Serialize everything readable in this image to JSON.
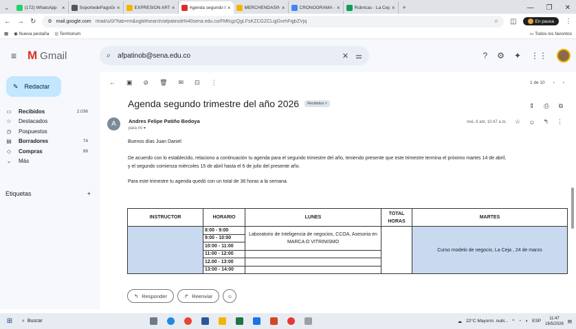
{
  "browser": {
    "tabs": [
      {
        "label": "(172) WhatsApp",
        "color": "#25d366"
      },
      {
        "label": "SoportedePagoGen",
        "color": "#555555"
      },
      {
        "label": "EXPRESIÓN ARTÍSTIC",
        "color": "#f4b400"
      },
      {
        "label": "Agenda segundo tri",
        "color": "#d93025"
      },
      {
        "label": "MERCHENDASING",
        "color": "#f4b400"
      },
      {
        "label": "CRONOGRAMA - Do",
        "color": "#4285f4"
      },
      {
        "label": "Rúbricas - La Ceja",
        "color": "#0f9d58"
      }
    ],
    "new_tab": "+",
    "url_host": "mail.google.com",
    "url_path": "/mail/u/0/?tab=rm&ogbl#search/afpatinob%40sena.edu.co/FMfcgzQgLFsKZCGZCLqjGnrhFqjbZVjq",
    "profile_label": "En pausa",
    "bookmarks": [
      "Nueva pestaña",
      "Territorium"
    ],
    "bookmarks_right": "Todos los favoritos"
  },
  "gmail": {
    "app_name": "Gmail",
    "search_query": "afpatinob@sena.edu.co",
    "compose_label": "Redactar",
    "nav": [
      {
        "label": "Recibidos",
        "count": "2.036",
        "icon": "inbox-icon",
        "bold": true
      },
      {
        "label": "Destacados",
        "count": "",
        "icon": "star-icon",
        "bold": false
      },
      {
        "label": "Pospuestos",
        "count": "",
        "icon": "clock-icon",
        "bold": false
      },
      {
        "label": "Borradores",
        "count": "74",
        "icon": "draft-icon",
        "bold": true
      },
      {
        "label": "Compras",
        "count": "99",
        "icon": "tag-icon",
        "bold": true
      },
      {
        "label": "Más",
        "count": "",
        "icon": "chevron-down-icon",
        "bold": false
      }
    ],
    "labels_heading": "Etiquetas",
    "pagination": "1 de 10"
  },
  "email": {
    "subject": "Agenda segundo trimestre del año 2026",
    "label_badge": "Recibidos ×",
    "sender_initial": "A",
    "sender_name": "Andres Felipe Patiño Bedoya",
    "to": "para mí ▾",
    "date": "mié, 8 abr, 10:47 a.m.",
    "greeting": "Buenos días  Juan Daniel",
    "para1_line1": "De acuerdo con lo establecido, relaciono a continuación tu agenda para el segundo trimestre del año, teniendo presente que este trimestre termina el próximo martes 14 de abril,",
    "para1_line2": "y el segundo comienza miércoles 15 de abril hasta el 6 de julio del presente año.",
    "para2": "Para este trimestre tu agenda quedó con un total de 36 horas a la semana.",
    "table": {
      "headers": [
        "INSTRUCTOR",
        "HORARIO",
        "LUNES",
        "TOTAL HORAS",
        "MARTES"
      ],
      "hours": [
        "8:00 - 9:00",
        "9:00 - 10:00",
        "10:00 - 11:00",
        "11:00 - 12:00",
        "12.00 - 13:00",
        "13:00 - 14:00"
      ],
      "lunes": "Laboratorio de Inteligencia de negocios, CCOA, Asesoria en MARCA O VITRINISMO",
      "martes": "Curso modelo de negocio, La Ceja , 24 de marzo"
    },
    "reply_label": "Responder",
    "forward_label": "Reenviar"
  },
  "taskbar": {
    "search_label": "Buscar",
    "weather": "22°C  Mayorm. nubl...",
    "lang": "ESP",
    "time": "11:47",
    "date": "16/5/2026"
  }
}
